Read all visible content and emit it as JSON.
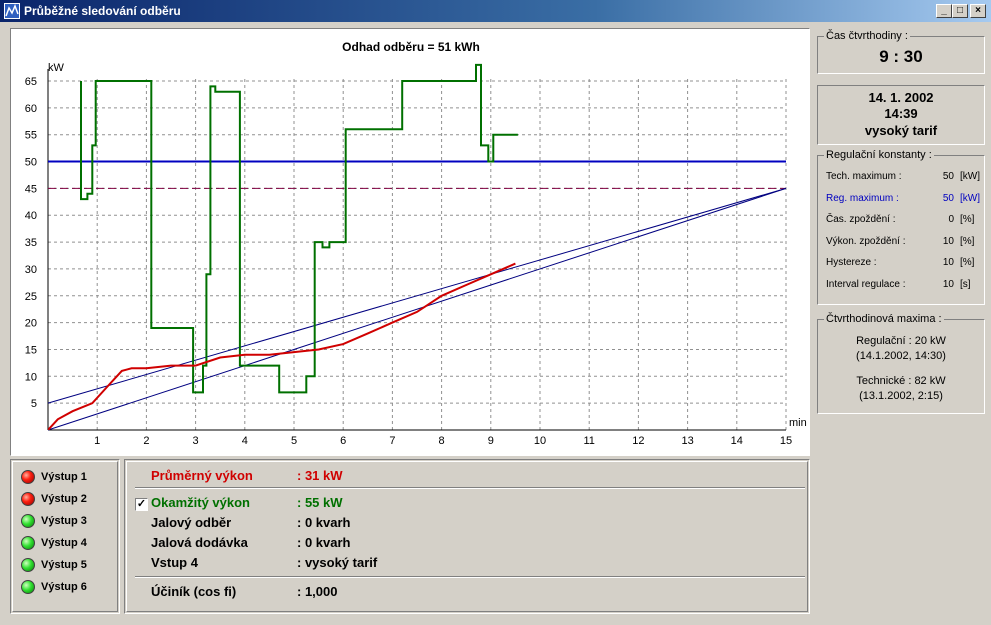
{
  "window": {
    "title": "Průběžné sledování odběru",
    "buttons": {
      "minimize": "_",
      "maximize": "□",
      "close": "×"
    }
  },
  "chart_data": {
    "type": "line",
    "title": "Odhad odběru = 51 kWh",
    "xlabel": "min",
    "ylabel": "kW",
    "xlim": [
      0,
      15
    ],
    "ylim": [
      0,
      65
    ],
    "xticks": [
      "1",
      "2",
      "3",
      "4",
      "5",
      "6",
      "7",
      "8",
      "9",
      "10",
      "11",
      "12",
      "13",
      "14",
      "15"
    ],
    "yticks": [
      "5",
      "10",
      "15",
      "20",
      "25",
      "30",
      "35",
      "40",
      "45",
      "50",
      "55",
      "60",
      "65"
    ],
    "grid": true,
    "reference_lines": [
      {
        "type": "horizontal",
        "y": 50,
        "color": "#0000c0",
        "style": "solid"
      },
      {
        "type": "horizontal",
        "y": 45,
        "color": "#800040",
        "style": "dashed"
      },
      {
        "type": "diagonal",
        "x1": 0,
        "y1": 0,
        "x2": 15,
        "y2": 45,
        "color": "#000080"
      },
      {
        "type": "diagonal",
        "x1": 0,
        "y1": 5,
        "x2": 15,
        "y2": 45,
        "color": "#000080"
      }
    ],
    "series": [
      {
        "color": "#007000",
        "x": [
          0.67,
          0.67,
          0.8,
          0.8,
          0.9,
          0.9,
          0.97,
          0.97,
          2.1,
          2.1,
          2.95,
          2.95,
          3.15,
          3.15,
          3.22,
          3.22,
          3.3,
          3.3,
          3.4,
          3.4,
          3.9,
          3.9,
          4.7,
          4.7,
          5.25,
          5.25,
          5.42,
          5.42,
          5.58,
          5.58,
          5.72,
          5.72,
          6.05,
          6.05,
          6.15,
          6.15,
          7.2,
          7.2,
          7.35,
          7.35,
          8.7,
          8.7,
          8.8,
          8.8,
          8.95,
          8.95,
          9.05,
          9.05,
          9.55
        ],
        "y": [
          65,
          43,
          43,
          44,
          44,
          53,
          53,
          65,
          65,
          19,
          19,
          7,
          7,
          12,
          12,
          29,
          29,
          64,
          64,
          63,
          63,
          12,
          12,
          7,
          7,
          10,
          10,
          35,
          35,
          34,
          34,
          35,
          35,
          56,
          56,
          56,
          56,
          65,
          65,
          65,
          65,
          68,
          68,
          53,
          53,
          50,
          50,
          55,
          55
        ]
      },
      {
        "color": "#d00000",
        "x": [
          0,
          0.2,
          0.5,
          0.9,
          1.2,
          1.5,
          1.7,
          2.0,
          2.5,
          3.0,
          3.5,
          4.0,
          4.5,
          5.0,
          5.5,
          6.0,
          6.5,
          7.0,
          7.5,
          8.0,
          8.5,
          9.0,
          9.5
        ],
        "y": [
          0,
          2,
          3.5,
          5,
          8,
          11,
          11.5,
          11.5,
          12,
          12,
          13.5,
          14,
          14,
          14.5,
          15,
          16,
          18,
          20,
          22,
          25,
          27,
          29,
          31
        ]
      }
    ]
  },
  "outputs": [
    {
      "label": "Výstup 1",
      "state": "red"
    },
    {
      "label": "Výstup 2",
      "state": "red"
    },
    {
      "label": "Výstup 3",
      "state": "green"
    },
    {
      "label": "Výstup 4",
      "state": "green"
    },
    {
      "label": "Výstup 5",
      "state": "green"
    },
    {
      "label": "Výstup 6",
      "state": "green"
    }
  ],
  "info": {
    "avg": {
      "label": "Průměrný výkon",
      "value": ": 31 kW",
      "color": "#d00000"
    },
    "inst": {
      "label": "Okamžitý výkon",
      "value": ": 55 kW",
      "color": "#007000",
      "checked": "✓"
    },
    "reactive_consumption": {
      "label": "Jalový odběr",
      "value": ": 0 kvarh"
    },
    "reactive_supply": {
      "label": "Jalová dodávka",
      "value": ": 0 kvarh"
    },
    "input4": {
      "label": "Vstup 4",
      "value": ": vysoký tarif"
    },
    "power_factor": {
      "label": "Účiník (cos fi)",
      "value": ": 1,000"
    }
  },
  "quarter_time": {
    "title": "Čas čtvrthodiny :",
    "value": "9 : 30"
  },
  "datetime": {
    "date": "14. 1. 2002",
    "time": "14:39",
    "tariff": "vysoký tarif"
  },
  "reg_constants": {
    "title": "Regulační konstanty :",
    "rows": [
      {
        "label": "Tech. maximum :",
        "value": "50",
        "unit": "[kW]"
      },
      {
        "label": "Reg. maximum :",
        "value": "50",
        "unit": "[kW]",
        "color": "#0000c0"
      },
      {
        "label": "Čas. zpoždění :",
        "value": "0",
        "unit": "[%]"
      },
      {
        "label": "Výkon. zpoždění :",
        "value": "10",
        "unit": "[%]"
      },
      {
        "label": "Hystereze :",
        "value": "10",
        "unit": "[%]"
      },
      {
        "label": "Interval regulace :",
        "value": "10",
        "unit": "[s]"
      }
    ]
  },
  "quarter_maxima": {
    "title": "Čtvrthodinová maxima :",
    "regulation": "Regulační : 20 kW",
    "regulation_when": "(14.1.2002, 14:30)",
    "technical": "Technické : 82 kW",
    "technical_when": "(13.1.2002, 2:15)"
  }
}
